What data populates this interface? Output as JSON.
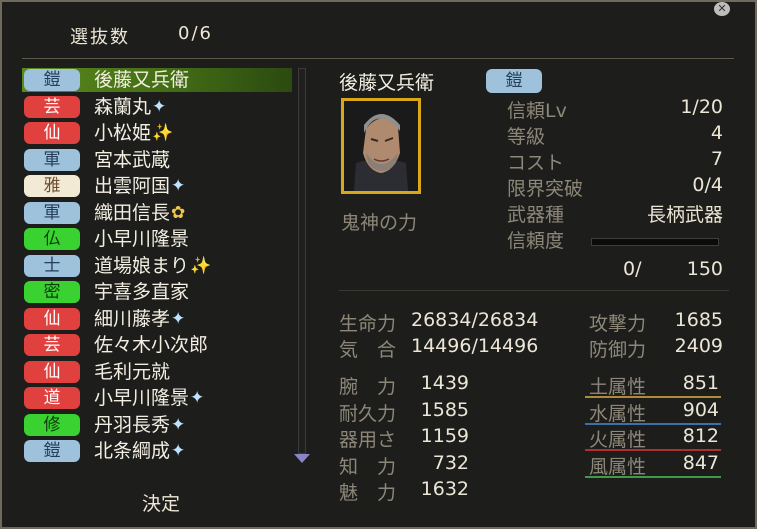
{
  "header": {
    "selected_label": "選抜数",
    "selected_count": "0/6"
  },
  "close_icon": "close-icon",
  "list": [
    {
      "badge": "鎧",
      "badge_color": "#9ec1dc",
      "name": "後藤又兵衛",
      "mark": ""
    },
    {
      "badge": "芸",
      "badge_color": "#e0403e",
      "name": "森蘭丸",
      "mark": "✦"
    },
    {
      "badge": "仙",
      "badge_color": "#e0403e",
      "name": "小松姫",
      "mark": "✨"
    },
    {
      "badge": "軍",
      "badge_color": "#9ec1dc",
      "name": "宮本武蔵",
      "mark": ""
    },
    {
      "badge": "雅",
      "badge_color": "#f3ead6",
      "name": "出雲阿国",
      "mark": "✦"
    },
    {
      "badge": "軍",
      "badge_color": "#9ec1dc",
      "name": "織田信長",
      "mark": "✿"
    },
    {
      "badge": "仏",
      "badge_color": "#39d230",
      "name": "小早川隆景",
      "mark": ""
    },
    {
      "badge": "士",
      "badge_color": "#9ec1dc",
      "name": "道場娘まり",
      "mark": "✨"
    },
    {
      "badge": "密",
      "badge_color": "#39d230",
      "name": "宇喜多直家",
      "mark": ""
    },
    {
      "badge": "仙",
      "badge_color": "#e0403e",
      "name": "細川藤孝",
      "mark": "✦"
    },
    {
      "badge": "芸",
      "badge_color": "#e0403e",
      "name": "佐々木小次郎",
      "mark": ""
    },
    {
      "badge": "仙",
      "badge_color": "#e0403e",
      "name": "毛利元就",
      "mark": ""
    },
    {
      "badge": "道",
      "badge_color": "#e0403e",
      "name": "小早川隆景",
      "mark": "✦"
    },
    {
      "badge": "修",
      "badge_color": "#39d230",
      "name": "丹羽長秀",
      "mark": "✦"
    },
    {
      "badge": "鎧",
      "badge_color": "#9ec1dc",
      "name": "北条綱成",
      "mark": "✦"
    }
  ],
  "decide_label": "決定",
  "detail": {
    "name": "後藤又兵衛",
    "badge": "鎧",
    "skill": "鬼神の力",
    "stats": [
      {
        "label": "信頼Lv",
        "value": "1/20"
      },
      {
        "label": "等級",
        "value": "4"
      },
      {
        "label": "コスト",
        "value": "7"
      },
      {
        "label": "限界突破",
        "value": "0/4"
      },
      {
        "label": "武器種",
        "value": "長柄武器"
      },
      {
        "label": "信頼度",
        "value": ""
      }
    ],
    "trust_progress": 0,
    "trust_current": "0/",
    "trust_max": "150",
    "hp_label": "生命力",
    "hp_value": "26834/26834",
    "ki_label": "気　合",
    "ki_value": "14496/14496",
    "atk_label": "攻撃力",
    "atk_value": "1685",
    "def_label": "防御力",
    "def_value": "2409",
    "attrs": [
      {
        "label": "腕　力",
        "value": "1439"
      },
      {
        "label": "耐久力",
        "value": "1585"
      },
      {
        "label": "器用さ",
        "value": "1159"
      },
      {
        "label": "知　力",
        "value": "732"
      },
      {
        "label": "魅　力",
        "value": "1632"
      }
    ],
    "elements": [
      {
        "label": "土属性",
        "value": "851",
        "color": "#b08a3a"
      },
      {
        "label": "水属性",
        "value": "904",
        "color": "#3d6fa8"
      },
      {
        "label": "火属性",
        "value": "812",
        "color": "#b03030"
      },
      {
        "label": "風属性",
        "value": "847",
        "color": "#3f9a4a"
      }
    ]
  }
}
